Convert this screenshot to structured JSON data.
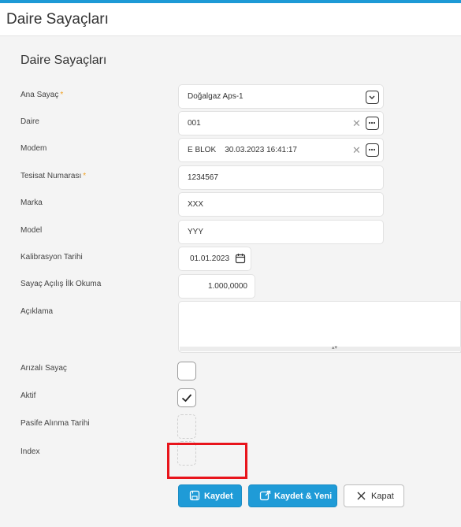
{
  "window": {
    "title": "Daire Sayaçları"
  },
  "form": {
    "title": "Daire Sayaçları",
    "fields": {
      "ana_sayac": {
        "label": "Ana Sayaç",
        "required": "*",
        "value": "Doğalgaz Aps-1"
      },
      "daire": {
        "label": "Daire",
        "value": "001"
      },
      "modem": {
        "label": "Modem",
        "value": "E BLOK    30.03.2023 16:41:17"
      },
      "tesisat": {
        "label": "Tesisat Numarası",
        "required": "*",
        "value": "1234567"
      },
      "marka": {
        "label": "Marka",
        "value": "XXX"
      },
      "model": {
        "label": "Model",
        "value": "YYY"
      },
      "kalibrasyon": {
        "label": "Kalibrasyon Tarihi",
        "value": "01.01.2023"
      },
      "ilk_okuma": {
        "label": "Sayaç Açılış İlk Okuma",
        "value": "1.000,0000"
      },
      "aciklama": {
        "label": "Açıklama",
        "value": ""
      },
      "arizali": {
        "label": "Arızalı Sayaç",
        "checked": false
      },
      "aktif": {
        "label": "Aktif",
        "checked": true
      },
      "pasife_alinma": {
        "label": "Pasife Alınma Tarihi"
      },
      "index": {
        "label": "Index"
      }
    }
  },
  "buttons": {
    "save": "Kaydet",
    "save_new": "Kaydet & Yeni",
    "close": "Kapat"
  },
  "colors": {
    "accent": "#1f9bd7",
    "highlight": "#e8141b",
    "required": "#f0a020"
  }
}
